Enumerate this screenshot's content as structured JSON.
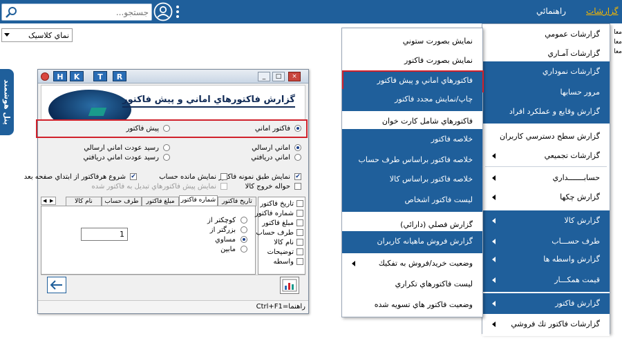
{
  "topbar": {
    "search_placeholder": "جستجو...",
    "menu_help": "راهنمائي",
    "menu_reports": "گزارشات"
  },
  "view_select": {
    "value": "نماي كلاسيک"
  },
  "side_tab": {
    "label": "پنل هوشمند"
  },
  "right_edge": {
    "lines": [
      "معا",
      "معا",
      "معا"
    ]
  },
  "dialog": {
    "title_buttons": [
      "H",
      "K",
      "T",
      "R"
    ],
    "window_controls": [
      "_",
      "□",
      "×"
    ],
    "banner_title": "گزارش فاکتورهاي اماني و پيش فاکتور",
    "type_options": [
      {
        "label": "فاکتور اماني",
        "selected": true
      },
      {
        "label": "پيش فاکتور",
        "selected": false
      }
    ],
    "sub_options": [
      {
        "label": "اماني ارسالي",
        "selected": true
      },
      {
        "label": "رسيد عودت اماني ارسالي",
        "selected": false
      },
      {
        "label": "اماني دريافتي",
        "selected": false
      },
      {
        "label": "رسيد عودت اماني دريافتي",
        "selected": false
      }
    ],
    "checkbox_options": [
      {
        "label": "نمايش طبق نمونه فاکتور",
        "checked": true,
        "disabled": false
      },
      {
        "label": "نمايش مانده حساب",
        "checked": false,
        "disabled": false
      },
      {
        "label": "شروع هرفاكتور از ابتداي صفحه بعد",
        "checked": true,
        "disabled": false
      },
      {
        "label": "حواله خروج كالا",
        "checked": false,
        "disabled": false
      },
      {
        "label": "نمايش پيش فاکتورهاي تبديل به فاکتور شده",
        "checked": false,
        "disabled": true
      }
    ],
    "tabs": [
      "تاريخ فاكتور",
      "شماره فاکتور",
      "مبلغ فاكتور",
      "طرف حساب",
      "نام كالا"
    ],
    "active_tab": "شماره فاکتور",
    "compare_options": [
      {
        "label": "کوچکتر از",
        "selected": false
      },
      {
        "label": "بزرگتر از",
        "selected": false
      },
      {
        "label": "مساوي",
        "selected": true
      },
      {
        "label": "مابين",
        "selected": false
      }
    ],
    "number_value": "1",
    "filter_checklist": [
      "تاريخ فاكتور",
      "شماره فاكتور",
      "مبلغ فاكتور",
      "طرف حساب",
      "نام كالا",
      "توضيحات",
      "واسطه"
    ],
    "status_text": "راهنما=Ctrl+F1"
  },
  "main_menu": {
    "items": [
      {
        "label": "گزارشات عمومي",
        "style": "white",
        "submenu": false
      },
      {
        "label": "گزارشات آمـاري",
        "style": "white",
        "submenu": false
      },
      {
        "label": "گزارشات نموداري",
        "style": "blue",
        "submenu": false
      },
      {
        "label": "مرور حسابها",
        "style": "blue",
        "submenu": false
      },
      {
        "label": "گزارش وقايع و عملكرد افراد",
        "style": "blue",
        "submenu": false
      },
      {
        "label": "گزارش سطح دسترسي كاربران",
        "style": "white",
        "submenu": false
      },
      {
        "label": "گزارشات تجميعي",
        "style": "white",
        "submenu": true
      },
      {
        "label": "حسابـــــــداري",
        "style": "white",
        "submenu": true
      },
      {
        "label": "گزارش چكها",
        "style": "white",
        "submenu": true
      },
      {
        "label": "گزارش كالا",
        "style": "blue",
        "submenu": true
      },
      {
        "label": "طرف حســـاب",
        "style": "blue",
        "submenu": true
      },
      {
        "label": "گزارش واسطه ها",
        "style": "blue",
        "submenu": true
      },
      {
        "label": "قيمت همكـــار",
        "style": "blue",
        "submenu": true
      },
      {
        "label": "گزارش فاكتور",
        "style": "blue",
        "submenu": true
      },
      {
        "label": "گزارشات فاكتور تك فروشي",
        "style": "white",
        "submenu": true
      }
    ]
  },
  "sub_menu": {
    "items": [
      {
        "label": "نمايش بصورت ستوني",
        "style": "white",
        "submenu": false
      },
      {
        "label": "نمايش بصورت فاكتور",
        "style": "white",
        "submenu": false
      },
      {
        "label": "فاكتورهاي اماني و پيش فاكتور",
        "style": "blue",
        "submenu": false
      },
      {
        "label": "چاپ/نمايش مجدد فاكتور",
        "style": "blue",
        "submenu": false
      },
      {
        "label": "فاكتورهاي شامل كارت خوان",
        "style": "white",
        "submenu": false
      },
      {
        "label": "خلاصه فاكتور",
        "style": "blue",
        "submenu": false
      },
      {
        "label": "خلاصه فاكتور براساس طرف حساب",
        "style": "blue",
        "submenu": false
      },
      {
        "label": "خلاصه فاكتور براساس كالا",
        "style": "blue",
        "submenu": false
      },
      {
        "label": "ليست فاكتور اشخاص",
        "style": "blue",
        "submenu": false
      },
      {
        "label": "گزارش فصلي (دارائي)",
        "style": "white",
        "submenu": false
      },
      {
        "label": "گزارش فروش ماهيانه كاربران",
        "style": "blue",
        "submenu": false
      },
      {
        "label": "وضعيت خريد/فروش به تفكيك",
        "style": "white",
        "submenu": true
      },
      {
        "label": "ليست فاكتورهاي تكراري",
        "style": "white",
        "submenu": false
      },
      {
        "label": "وضعيت فاكتور هاي تسويه شده",
        "style": "white",
        "submenu": false
      }
    ]
  },
  "colors": {
    "topbar": "#1f5f9b",
    "menu_blue": "#1f5f9b",
    "highlight": "#d0202a",
    "accent": "#f5b700"
  }
}
